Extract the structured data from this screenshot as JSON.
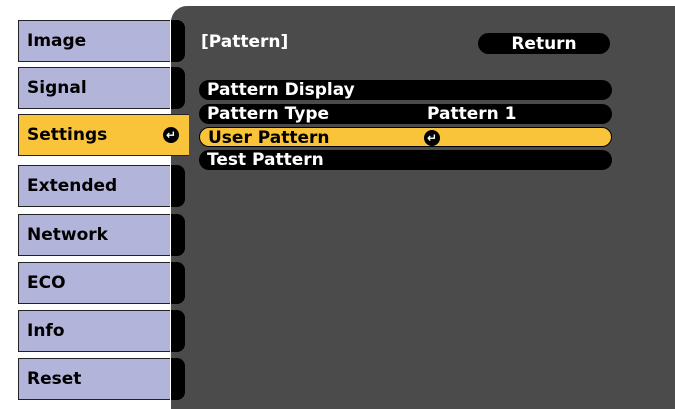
{
  "sidebar": {
    "items": [
      {
        "label": "Image"
      },
      {
        "label": "Signal"
      },
      {
        "label": "Settings"
      },
      {
        "label": "Extended"
      },
      {
        "label": "Network"
      },
      {
        "label": "ECO"
      },
      {
        "label": "Info"
      },
      {
        "label": "Reset"
      }
    ],
    "active_index": 2
  },
  "panel": {
    "title": "[Pattern]",
    "return_label": "Return",
    "rows": [
      {
        "label": "Pattern Display",
        "value": ""
      },
      {
        "label": "Pattern Type",
        "value": "Pattern 1"
      },
      {
        "label": "User Pattern",
        "value": ""
      },
      {
        "label": "Test Pattern",
        "value": ""
      }
    ],
    "active_row_index": 2
  },
  "colors": {
    "tab": "#b3b4d9",
    "active": "#f9c43a",
    "panel": "#4b4b4b",
    "row": "#000000"
  },
  "icons": {
    "enter": "enter-icon"
  }
}
